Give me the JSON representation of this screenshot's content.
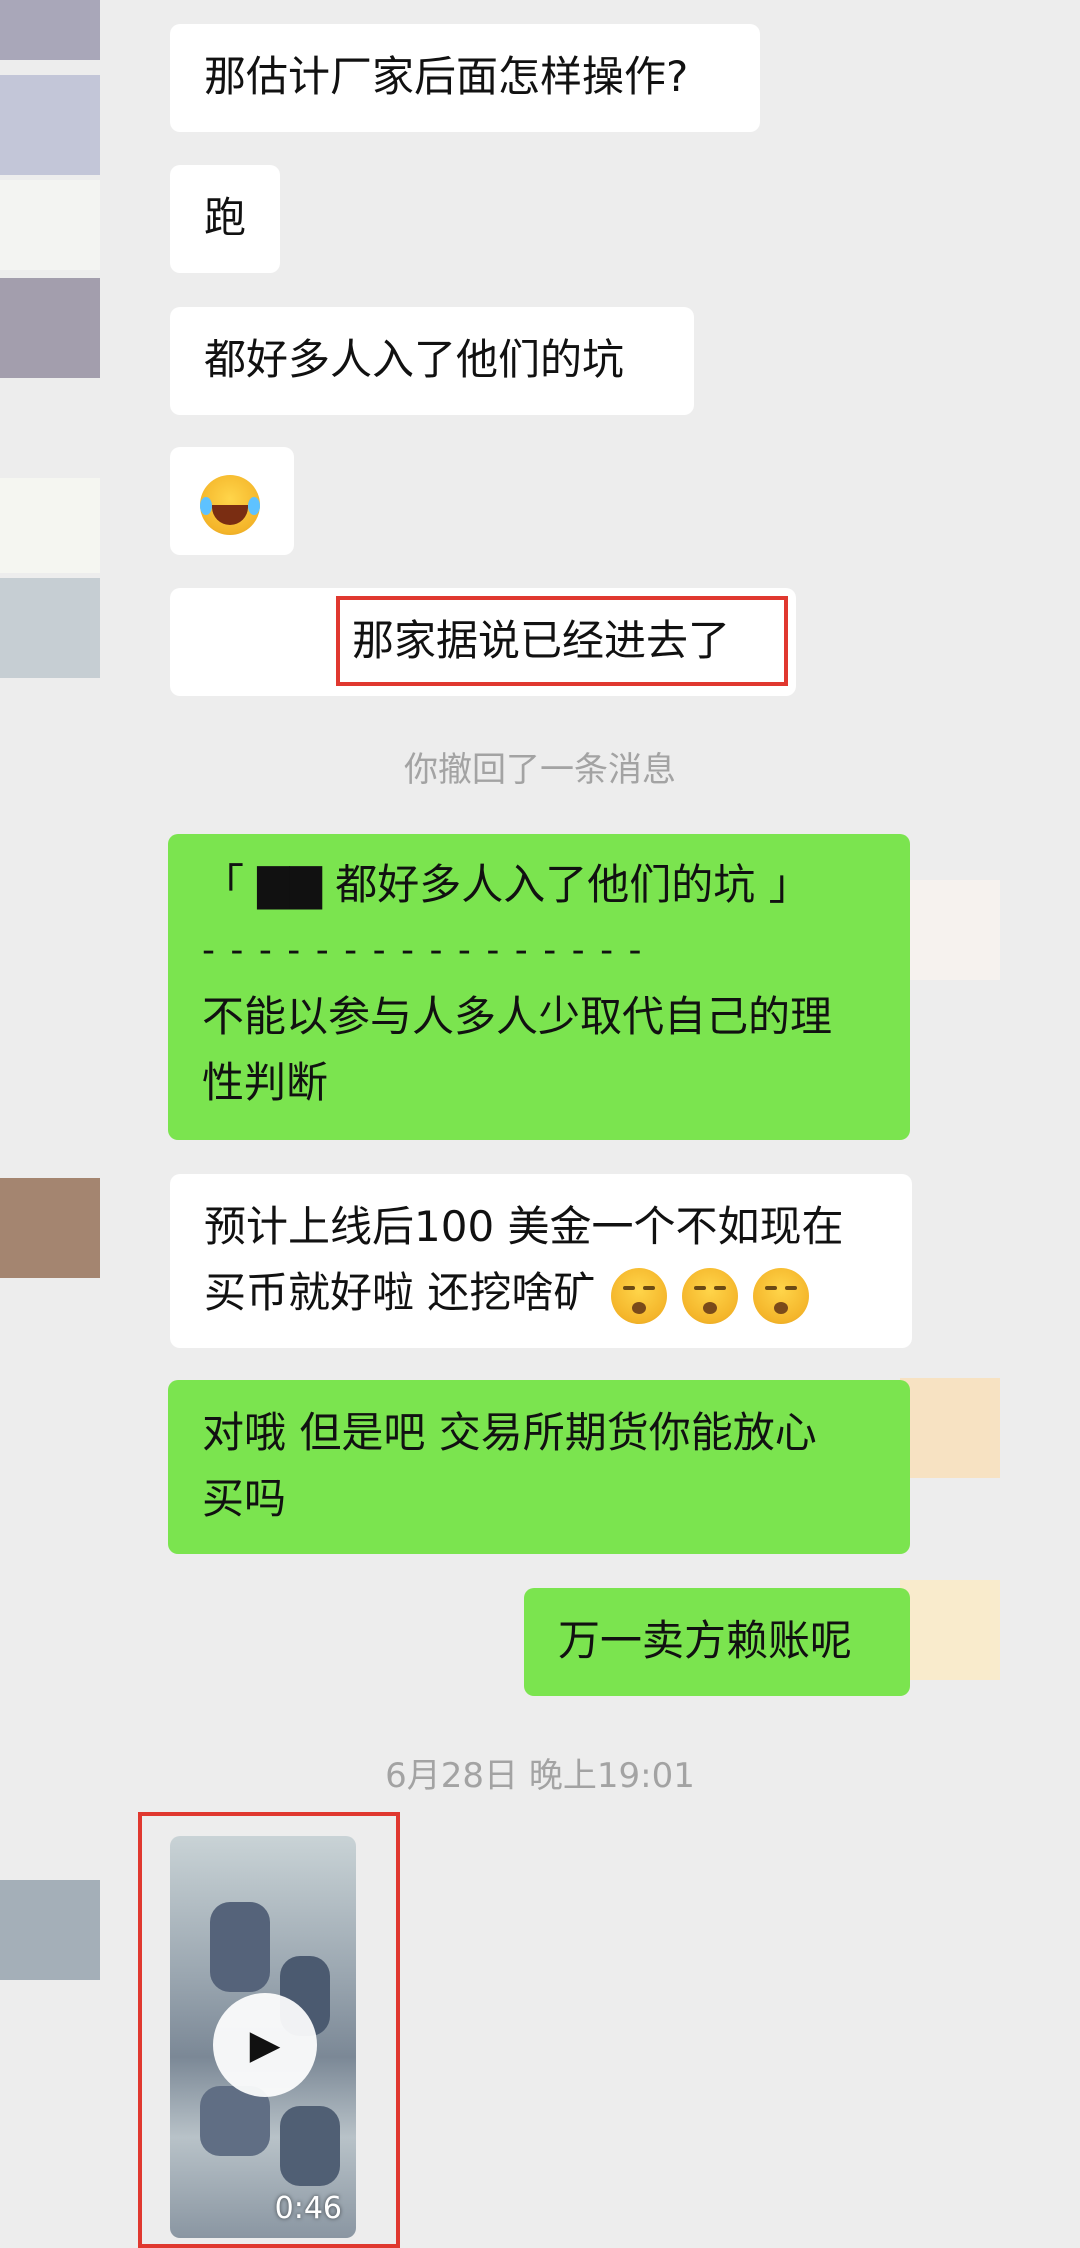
{
  "messages": [
    {
      "side": "in",
      "lines": [
        "那估计厂家后面怎样操作?"
      ]
    },
    {
      "side": "in",
      "lines": [
        "跑"
      ]
    },
    {
      "side": "in",
      "lines": [
        "都好多人入了他们的坑"
      ]
    },
    {
      "side": "in",
      "emoji": "laughing-tears-emoji"
    },
    {
      "side": "in",
      "lines": [
        "那家据说已经进去了"
      ]
    },
    {
      "system": "你撤回了一条消息"
    },
    {
      "side": "out",
      "lines": [
        "「 ▇▇ 都好多人入了他们的坑 」",
        "- - - - - - - - - - - - - - - -",
        "不能以参与人多人少取代自己的理",
        "性判断"
      ]
    },
    {
      "side": "in",
      "lines": [
        "预计上线后100 美金一个不如现在",
        "买币就好啦 还挖啥矿"
      ],
      "emojis": [
        "sleeping-emoji",
        "sleeping-emoji",
        "sleeping-emoji"
      ]
    },
    {
      "side": "out",
      "lines": [
        "对哦 但是吧 交易所期货你能放心",
        "买吗"
      ]
    },
    {
      "side": "out",
      "lines": [
        "万一卖方赖账呢"
      ]
    },
    {
      "system": "6月28日 晚上19:01"
    }
  ],
  "video": {
    "duration": "0:46",
    "play_icon": "play-icon"
  },
  "colors": {
    "background": "#ededed",
    "incoming": "#ffffff",
    "outgoing": "#7be44f",
    "highlight": "#e0382f"
  }
}
